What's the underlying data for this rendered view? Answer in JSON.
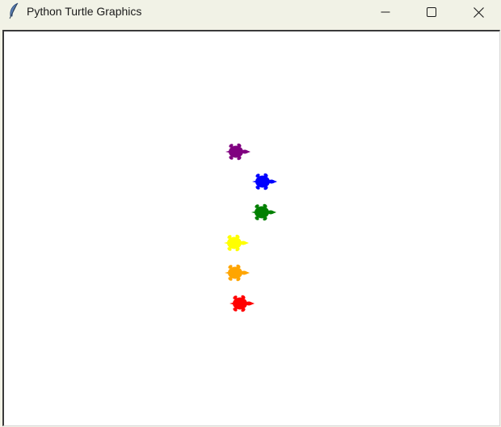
{
  "window": {
    "title": "Python Turtle Graphics",
    "icon": "feather-icon",
    "controls": [
      "minimize-icon",
      "maximize-icon",
      "close-icon"
    ]
  },
  "canvas": {
    "background": "#ffffff",
    "turtles": [
      {
        "color": "#800080",
        "heading": "east"
      },
      {
        "color": "#0000ff",
        "heading": "east"
      },
      {
        "color": "#008000",
        "heading": "east"
      },
      {
        "color": "#ffff00",
        "heading": "east"
      },
      {
        "color": "#ffa500",
        "heading": "east"
      },
      {
        "color": "#ff0000",
        "heading": "east"
      }
    ]
  }
}
